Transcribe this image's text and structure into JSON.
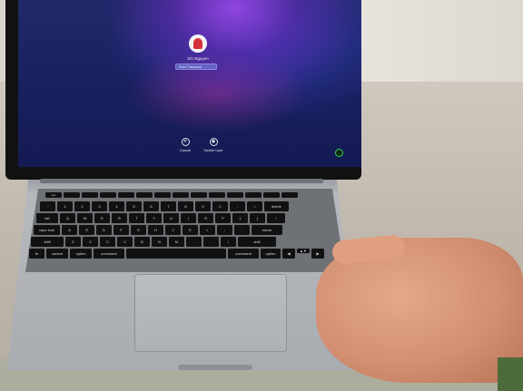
{
  "login_screen": {
    "username": "SG Nguyen",
    "password_placeholder": "Enter Password",
    "buttons": [
      {
        "label": "Cancel",
        "icon": "close-icon"
      },
      {
        "label": "Switch User",
        "icon": "switch-user-icon"
      }
    ],
    "power_indicator": "power-icon"
  },
  "keyboard": {
    "rows": [
      [
        "~",
        "1",
        "2",
        "3",
        "4",
        "5",
        "6",
        "7",
        "8",
        "9",
        "0",
        "-",
        "=",
        "delete"
      ],
      [
        "tab",
        "Q",
        "W",
        "E",
        "R",
        "T",
        "Y",
        "U",
        "I",
        "O",
        "P",
        "[",
        "]",
        "\\"
      ],
      [
        "caps lock",
        "A",
        "S",
        "D",
        "F",
        "G",
        "H",
        "J",
        "K",
        "L",
        ";",
        "'",
        "return"
      ],
      [
        "shift",
        "Z",
        "X",
        "C",
        "V",
        "B",
        "N",
        "M",
        ",",
        ".",
        "/",
        "shift"
      ],
      [
        "fn",
        "control",
        "option",
        "command",
        "",
        "command",
        "option",
        "◀",
        "▲▼",
        "▶"
      ]
    ]
  },
  "colors": {
    "screen_bg": "#182060",
    "power_led": "#2ed34a"
  }
}
